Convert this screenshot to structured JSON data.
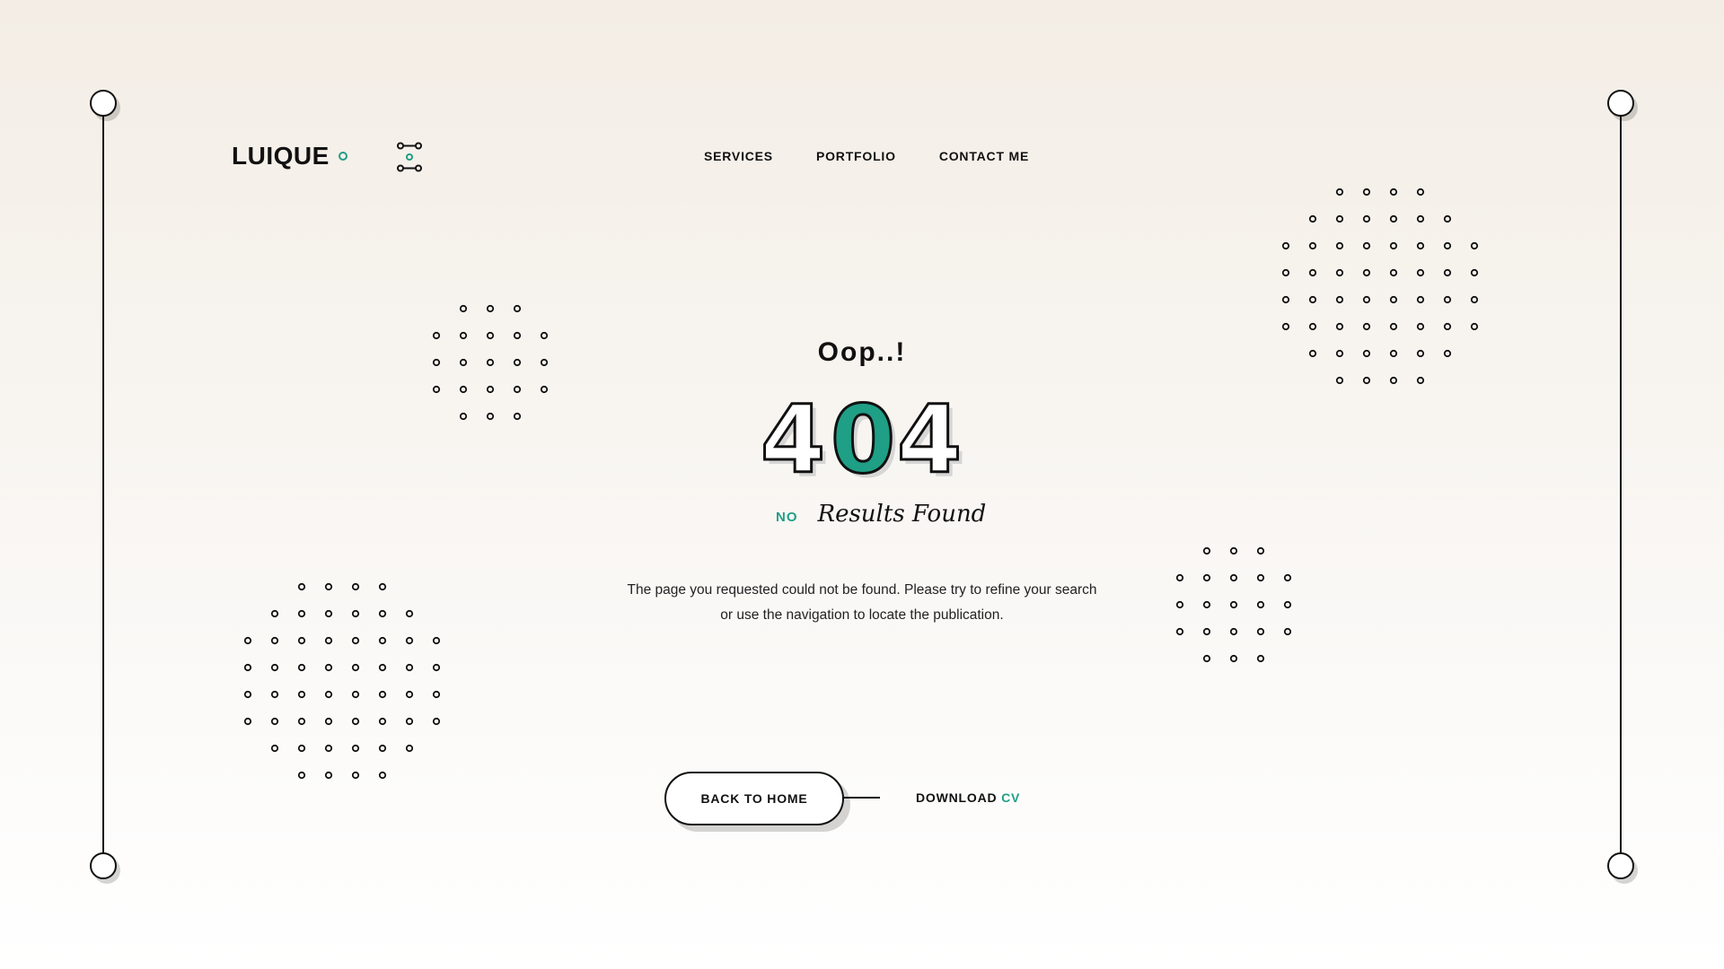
{
  "brand": {
    "name": "LUIQUE",
    "accent_color": "#1f9f86"
  },
  "header": {
    "menu_icon": "menu-toggle-icon",
    "nav": [
      "SERVICES",
      "PORTFOLIO",
      "CONTACT ME"
    ]
  },
  "error": {
    "heading": "Oop..!",
    "code": [
      "4",
      "0",
      "4"
    ],
    "subtitle_prefix": "NO",
    "subtitle_text": "Results Found",
    "message_line1": "The page you requested could not be found. Please try to refine your search",
    "message_line2": "or use the navigation to locate the publication."
  },
  "actions": {
    "home_label": "BACK TO HOME",
    "cv_label": "DOWNLOAD",
    "cv_accent": "CV"
  }
}
